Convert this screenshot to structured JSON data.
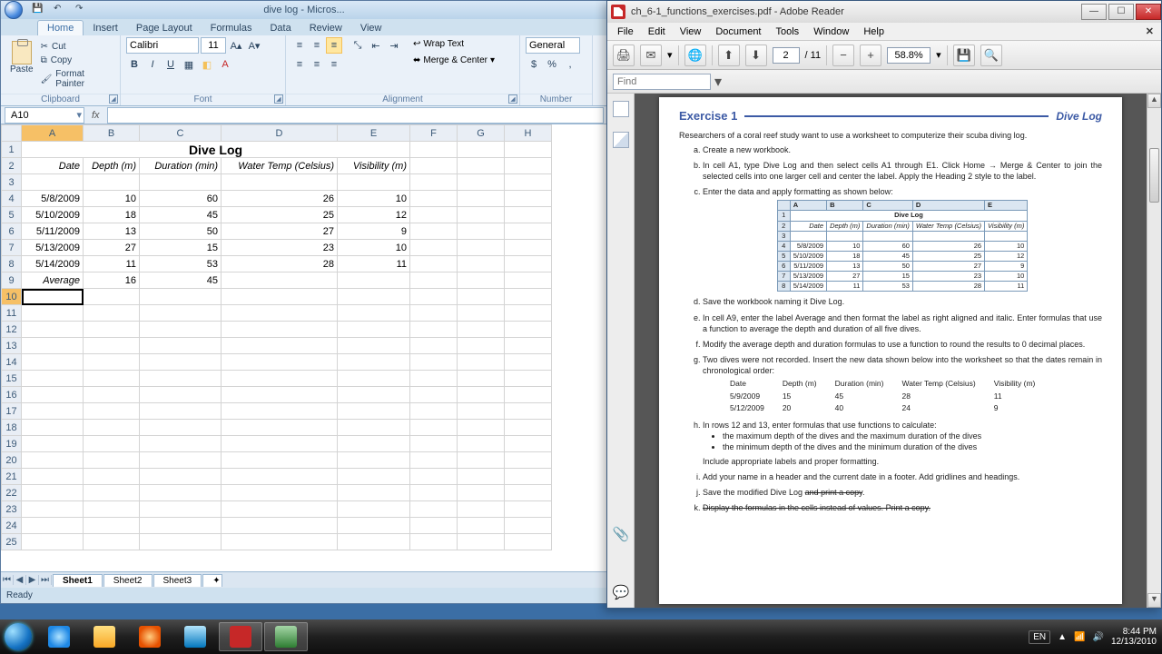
{
  "excel": {
    "title": "dive log - Micros...",
    "tabs": [
      "Home",
      "Insert",
      "Page Layout",
      "Formulas",
      "Data",
      "Review",
      "View"
    ],
    "clipboard": {
      "label": "Clipboard",
      "paste": "Paste",
      "cut": "Cut",
      "copy": "Copy",
      "fp": "Format Painter"
    },
    "font": {
      "label": "Font",
      "name": "Calibri",
      "size": "11"
    },
    "align": {
      "label": "Alignment",
      "wrap": "Wrap Text",
      "merge": "Merge & Center"
    },
    "number": {
      "label": "Number",
      "format": "General"
    },
    "namebox": "A10",
    "headers": {
      "A": "Date",
      "B": "Depth (m)",
      "C": "Duration (min)",
      "D": "Water Temp (Celsius)",
      "E": "Visibility (m)"
    },
    "diveTitle": "Dive Log",
    "rows": [
      {
        "A": "5/8/2009",
        "B": "10",
        "C": "60",
        "D": "26",
        "E": "10"
      },
      {
        "A": "5/10/2009",
        "B": "18",
        "C": "45",
        "D": "25",
        "E": "12"
      },
      {
        "A": "5/11/2009",
        "B": "13",
        "C": "50",
        "D": "27",
        "E": "9"
      },
      {
        "A": "5/13/2009",
        "B": "27",
        "C": "15",
        "D": "23",
        "E": "10"
      },
      {
        "A": "5/14/2009",
        "B": "11",
        "C": "53",
        "D": "28",
        "E": "11"
      }
    ],
    "avg": {
      "label": "Average",
      "B": "16",
      "C": "45"
    },
    "sheets": [
      "Sheet1",
      "Sheet2",
      "Sheet3"
    ],
    "status": "Ready"
  },
  "reader": {
    "title": "ch_6-1_functions_exercises.pdf - Adobe Reader",
    "menu": [
      "File",
      "Edit",
      "View",
      "Document",
      "Tools",
      "Window",
      "Help"
    ],
    "page": "2",
    "pages": "/ 11",
    "zoom": "58.8%",
    "find": "Find",
    "ex_title": "Exercise  1",
    "ex_badge": "Dive Log",
    "intro": "Researchers of a coral reef study want to use a worksheet to computerize their scuba diving log.",
    "a": "Create a new workbook.",
    "b": "In cell A1, type Dive Log and then select cells A1 through E1. Click Home → Merge & Center to join the selected cells into one larger cell and center the label. Apply the Heading 2 style to the label.",
    "c": "Enter the data and apply formatting as shown below:",
    "mini_headers": [
      "Date",
      "Depth (m)",
      "Duration (min)",
      "Water Temp (Celsius)",
      "Visibility (m)"
    ],
    "mini_rows": [
      [
        "5/8/2009",
        "10",
        "60",
        "26",
        "10"
      ],
      [
        "5/10/2009",
        "18",
        "45",
        "25",
        "12"
      ],
      [
        "5/11/2009",
        "13",
        "50",
        "27",
        "9"
      ],
      [
        "5/13/2009",
        "27",
        "15",
        "23",
        "10"
      ],
      [
        "5/14/2009",
        "11",
        "53",
        "28",
        "11"
      ]
    ],
    "d": "Save the workbook naming it Dive Log.",
    "e": "In cell A9, enter the label Average and then format the label as right aligned and italic. Enter formulas that use a function to average the depth and duration of all five dives.",
    "f": "Modify the average depth and duration formulas to use a function to round the results to 0 decimal places.",
    "g": "Two dives were not recorded. Insert the new data shown below into the worksheet so that the dates remain in chronological order:",
    "g_head": [
      "Date",
      "Depth (m)",
      "Duration (min)",
      "Water Temp (Celsius)",
      "Visibility (m)"
    ],
    "g_rows": [
      [
        "5/9/2009",
        "15",
        "45",
        "28",
        "11"
      ],
      [
        "5/12/2009",
        "20",
        "40",
        "24",
        "9"
      ]
    ],
    "h": "In rows 12 and 13, enter formulas that use functions to calculate:",
    "h1": "the maximum depth of the dives and the maximum duration of the dives",
    "h2": "the minimum depth of the dives and the minimum duration of the dives",
    "h3": "Include appropriate labels and proper formatting.",
    "i": "Add your name in a header and the current date in a footer. Add gridlines and headings.",
    "j": "Save the modified Dive Log and print a copy.",
    "k": "Display the formulas in the cells instead of values. Print a copy."
  },
  "taskbar": {
    "lang": "EN",
    "time": "8:44 PM",
    "date": "12/13/2010"
  }
}
